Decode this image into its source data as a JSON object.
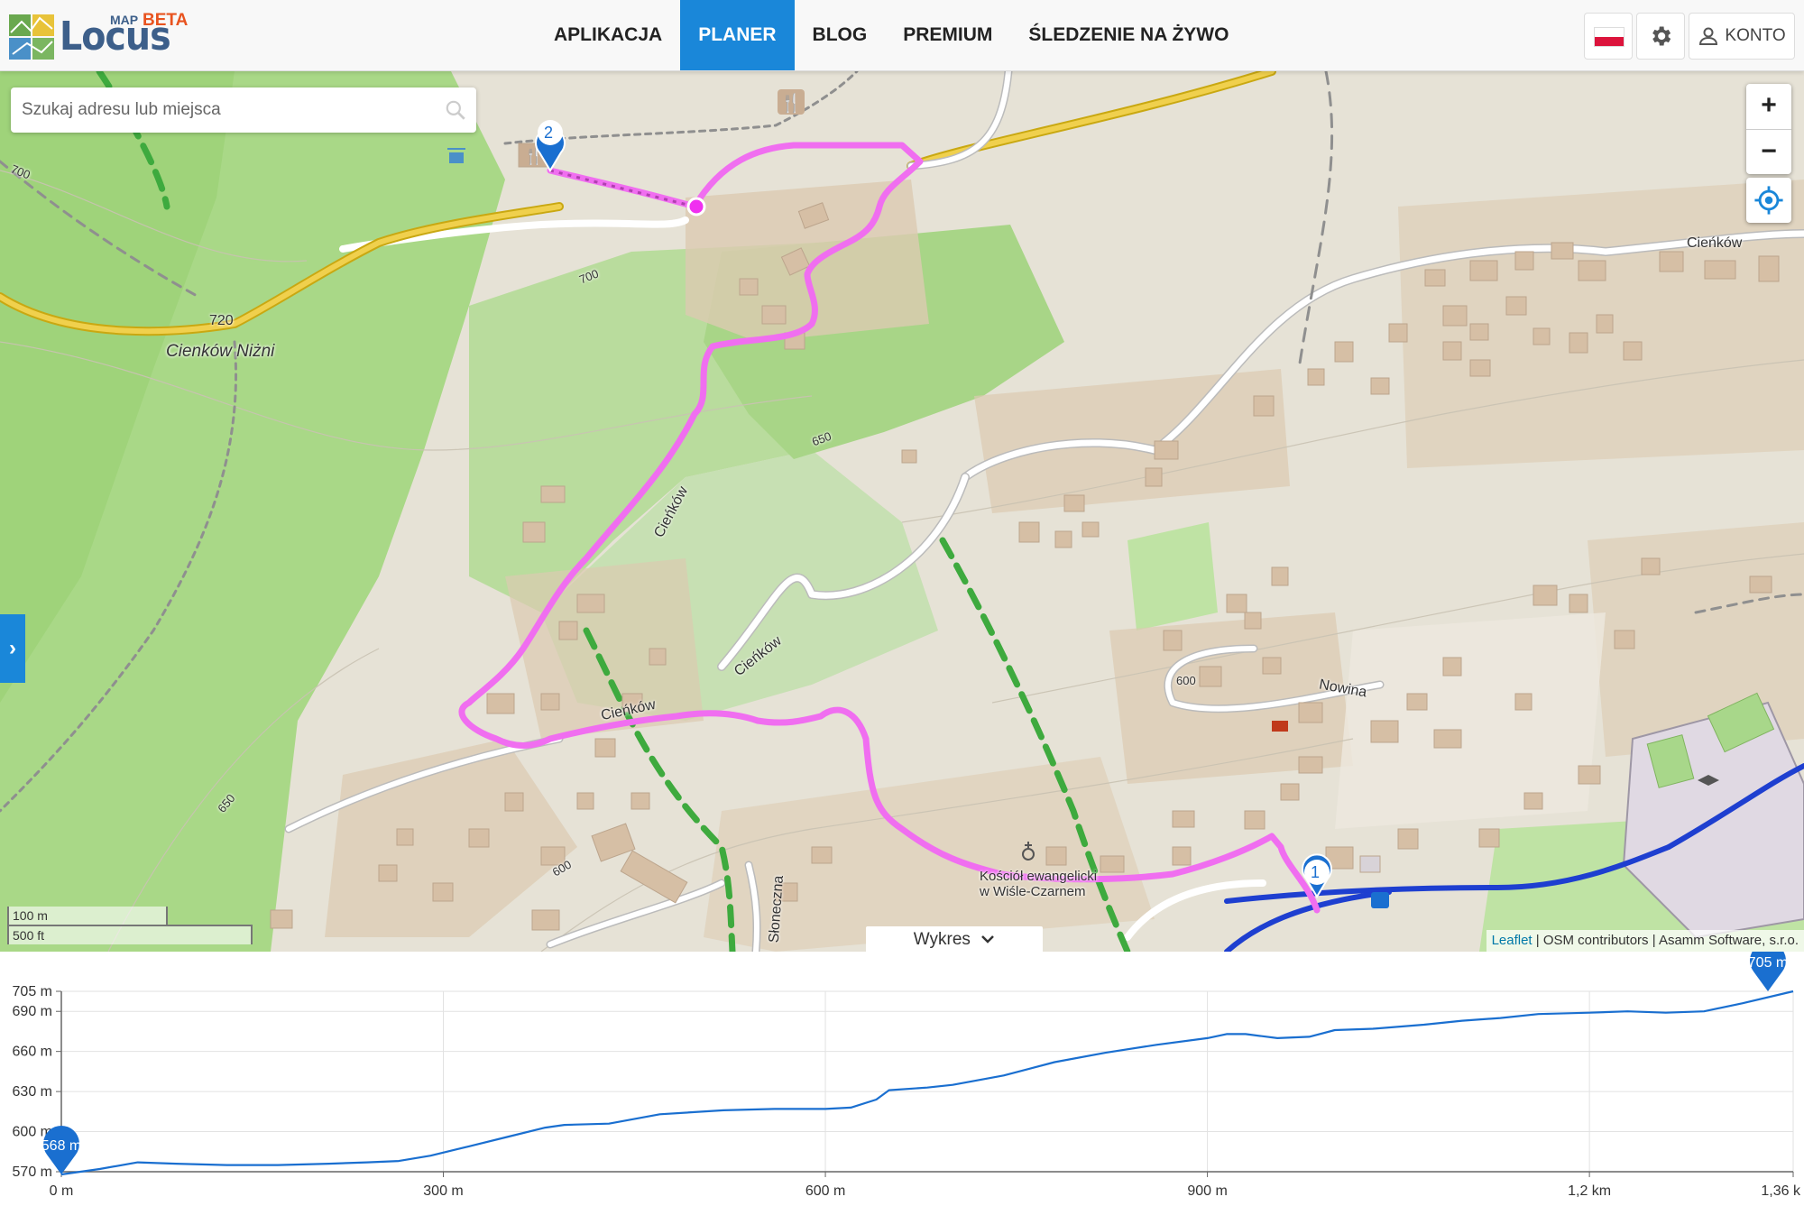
{
  "header": {
    "logo": {
      "word": "Locus",
      "map": "MAP",
      "beta": "BETA"
    },
    "nav": [
      {
        "label": "APLIKACJA",
        "active": false
      },
      {
        "label": "PLANER",
        "active": true
      },
      {
        "label": "BLOG",
        "active": false
      },
      {
        "label": "PREMIUM",
        "active": false
      },
      {
        "label": "ŚLEDZENIE NA ŻYWO",
        "active": false
      }
    ],
    "account_label": "KONTO",
    "language_flag": "pl"
  },
  "map": {
    "search_placeholder": "Szukaj adresu lub miejsca",
    "zoom_in": "+",
    "zoom_out": "−",
    "chart_toggle": "Wykres",
    "scale": {
      "metric": "100 m",
      "imperial": "500 ft"
    },
    "attribution": {
      "leaflet": "Leaflet",
      "rest": " | OSM contributors | Asamm Software, s.r.o."
    },
    "labels": {
      "place": "Cienków Niżni",
      "street1": "Cieńków",
      "street2": "Cieńków",
      "street3": "Cieńków",
      "street4": "Cieńków",
      "street_nowina": "Nowina",
      "street_sloneczna": "Słoneczna",
      "church_line1": "Kościół ewangelicki",
      "church_line2": "w Wiśle-Czarnem",
      "peak_elev": "720",
      "contours": [
        "700",
        "700",
        "650",
        "650",
        "600",
        "600"
      ]
    },
    "waypoints": [
      {
        "label": "1"
      },
      {
        "label": "2"
      }
    ],
    "route_color": "#f06ef0",
    "accent": "#1a87d9"
  },
  "chart_data": {
    "type": "area",
    "x_unit": "m",
    "y_unit": "m",
    "xlim": [
      0,
      1360
    ],
    "ylim": [
      570,
      705
    ],
    "x_ticks": [
      {
        "value": 0,
        "label": "0 m"
      },
      {
        "value": 300,
        "label": "300 m"
      },
      {
        "value": 600,
        "label": "600 m"
      },
      {
        "value": 900,
        "label": "900 m"
      },
      {
        "value": 1200,
        "label": "1,2 km"
      },
      {
        "value": 1360,
        "label": "1,36 k"
      }
    ],
    "y_ticks": [
      {
        "value": 570,
        "label": "570 m"
      },
      {
        "value": 600,
        "label": "600 m"
      },
      {
        "value": 630,
        "label": "630 m"
      },
      {
        "value": 660,
        "label": "660 m"
      },
      {
        "value": 690,
        "label": "690 m"
      },
      {
        "value": 705,
        "label": "705 m"
      }
    ],
    "start_marker": {
      "x": 0,
      "label": "568 m"
    },
    "end_marker": {
      "x": 1360,
      "label": "705 m"
    },
    "series": [
      {
        "x": [
          0,
          30,
          60,
          90,
          130,
          170,
          210,
          240,
          265,
          290,
          320,
          350,
          380,
          395,
          430,
          470,
          520,
          560,
          600,
          620,
          640,
          650,
          680,
          700,
          740,
          780,
          820,
          860,
          900,
          915,
          930,
          955,
          980,
          1000,
          1030,
          1070,
          1100,
          1130,
          1160,
          1200,
          1230,
          1260,
          1290,
          1320,
          1360
        ],
        "y": [
          568,
          572,
          577,
          576,
          575,
          575,
          576,
          577,
          578,
          582,
          589,
          596,
          603,
          605,
          606,
          613,
          616,
          617,
          617,
          618,
          624,
          631,
          633,
          635,
          642,
          652,
          659,
          665,
          670,
          673,
          673,
          670,
          671,
          676,
          677,
          680,
          683,
          685,
          688,
          689,
          690,
          689,
          690,
          696,
          705
        ],
        "color": "#1a6fd0"
      }
    ],
    "grid": true
  }
}
